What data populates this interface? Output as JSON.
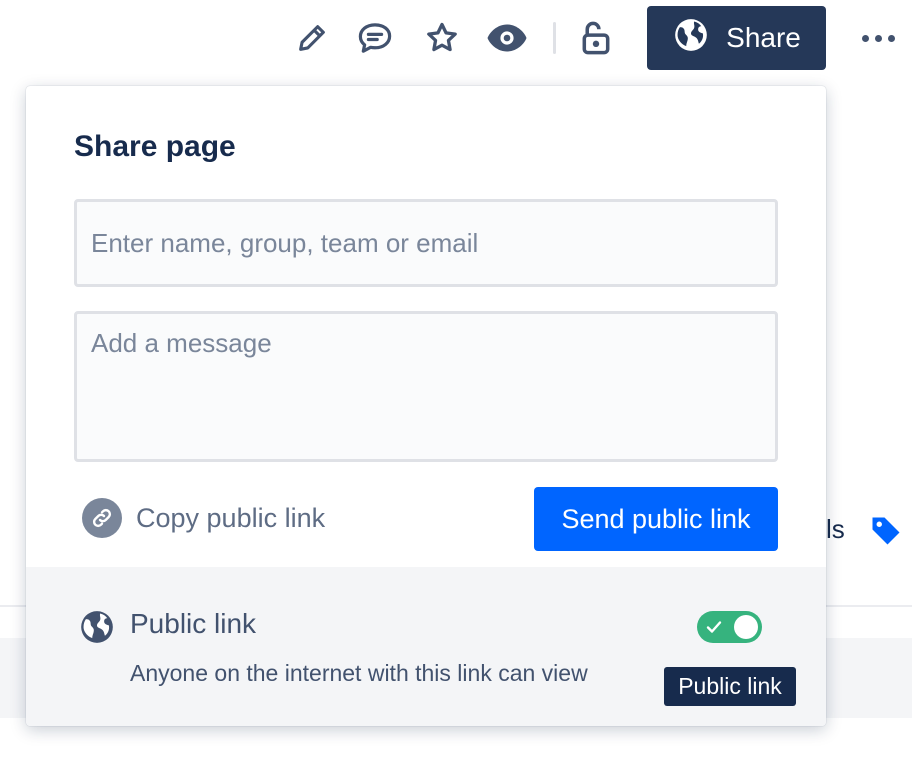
{
  "toolbar": {
    "icons": {
      "edit": "pencil-icon",
      "comment": "comment-icon",
      "star": "star-icon",
      "watch": "eye-icon",
      "restrictions": "unlock-icon",
      "more": "more-icon"
    },
    "share_label": "Share",
    "share_color": "#253858"
  },
  "background": {
    "partial_text": "ls",
    "tag_color": "#0065FF"
  },
  "dialog": {
    "title": "Share page",
    "recipient_placeholder": "Enter name, group, team or email",
    "message_placeholder": "Add a message",
    "copy_link_label": "Copy public link",
    "send_label": "Send public link",
    "send_color": "#0065FF",
    "footer": {
      "title": "Public link",
      "description": "Anyone on the internet with this link can view",
      "toggle_on": true,
      "toggle_color": "#36B37E"
    }
  },
  "tooltip": {
    "text": "Public link"
  }
}
